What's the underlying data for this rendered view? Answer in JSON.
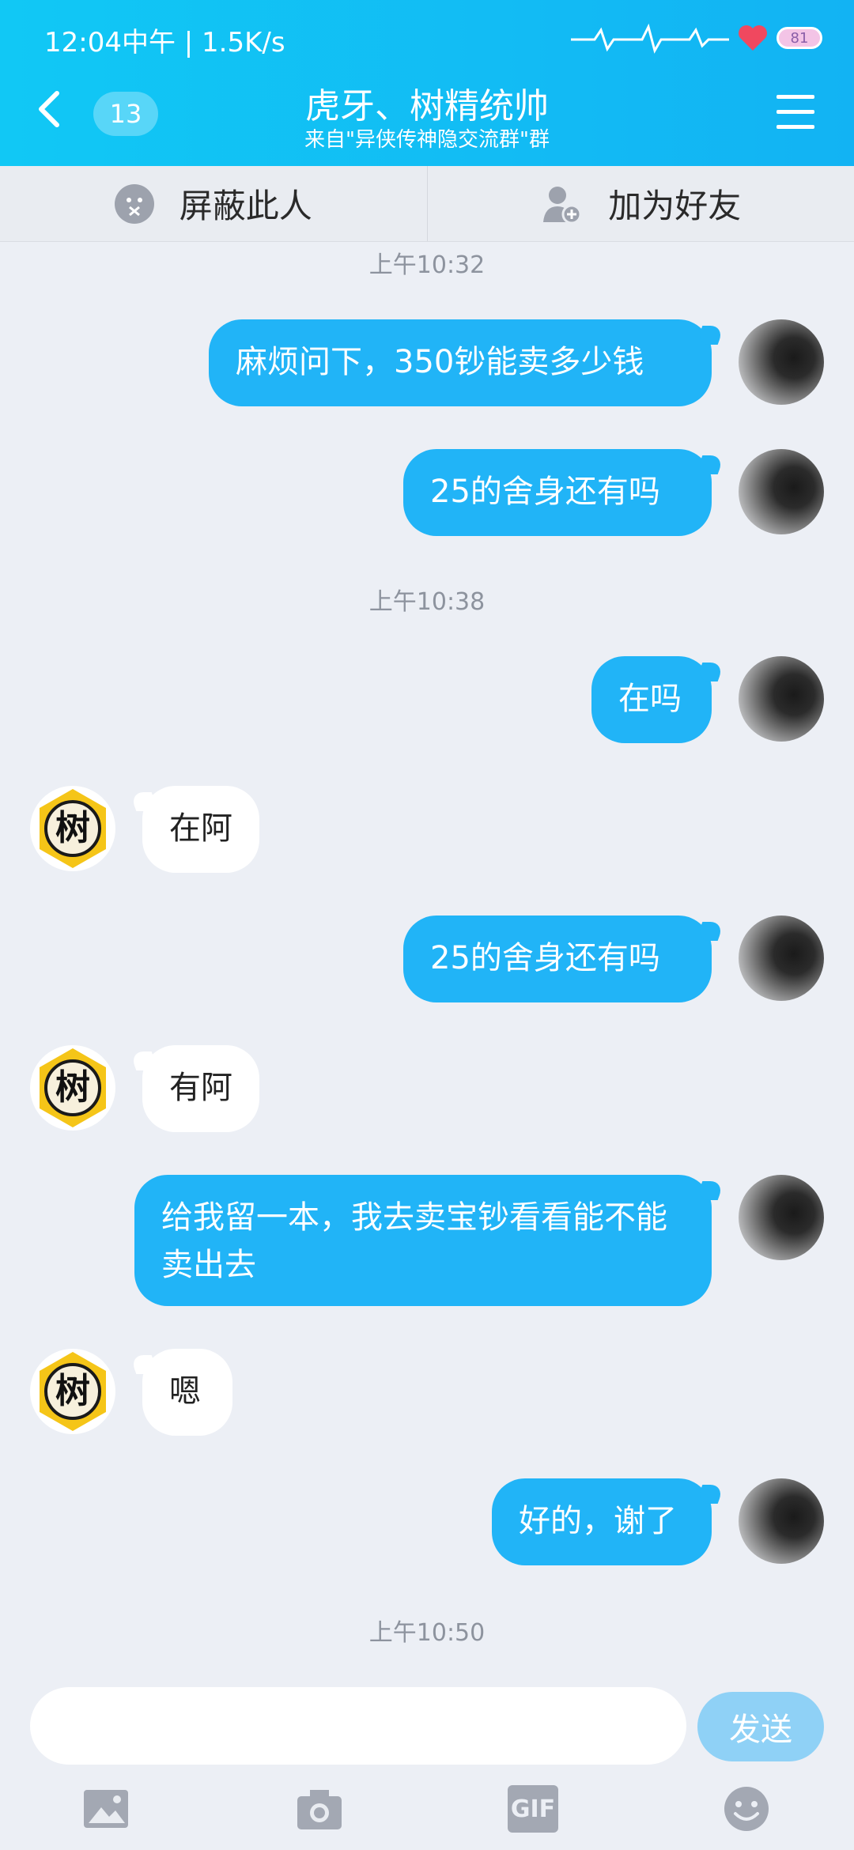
{
  "status_bar": {
    "time_speed": "12:04中午 | 1.5K/s",
    "battery": "81"
  },
  "header": {
    "unread_count": "13",
    "title": "虎牙、树精统帅",
    "subtitle": "来自\"异侠传神隐交流群\"群"
  },
  "actions": {
    "block": "屏蔽此人",
    "add_friend": "加为好友"
  },
  "avatar_text": "树",
  "messages": [
    {
      "type": "time",
      "text": "上午10:32"
    },
    {
      "type": "me",
      "text": "麻烦问下，350钞能卖多少钱"
    },
    {
      "type": "me",
      "text": "25的舍身还有吗"
    },
    {
      "type": "time",
      "text": "上午10:38"
    },
    {
      "type": "me",
      "text": "在吗"
    },
    {
      "type": "other",
      "text": "在阿"
    },
    {
      "type": "me",
      "text": "25的舍身还有吗"
    },
    {
      "type": "other",
      "text": "有阿"
    },
    {
      "type": "me",
      "text": "给我留一本，我去卖宝钞看看能不能卖出去"
    },
    {
      "type": "other",
      "text": "嗯"
    },
    {
      "type": "me",
      "text": "好的，谢了"
    },
    {
      "type": "time",
      "text": "上午10:50"
    }
  ],
  "composer": {
    "input_value": "",
    "send_label": "发送"
  },
  "toolbar": {
    "icons": [
      "image-icon",
      "camera-icon",
      "gif-icon",
      "emoji-icon"
    ],
    "gif_label": "GIF"
  }
}
